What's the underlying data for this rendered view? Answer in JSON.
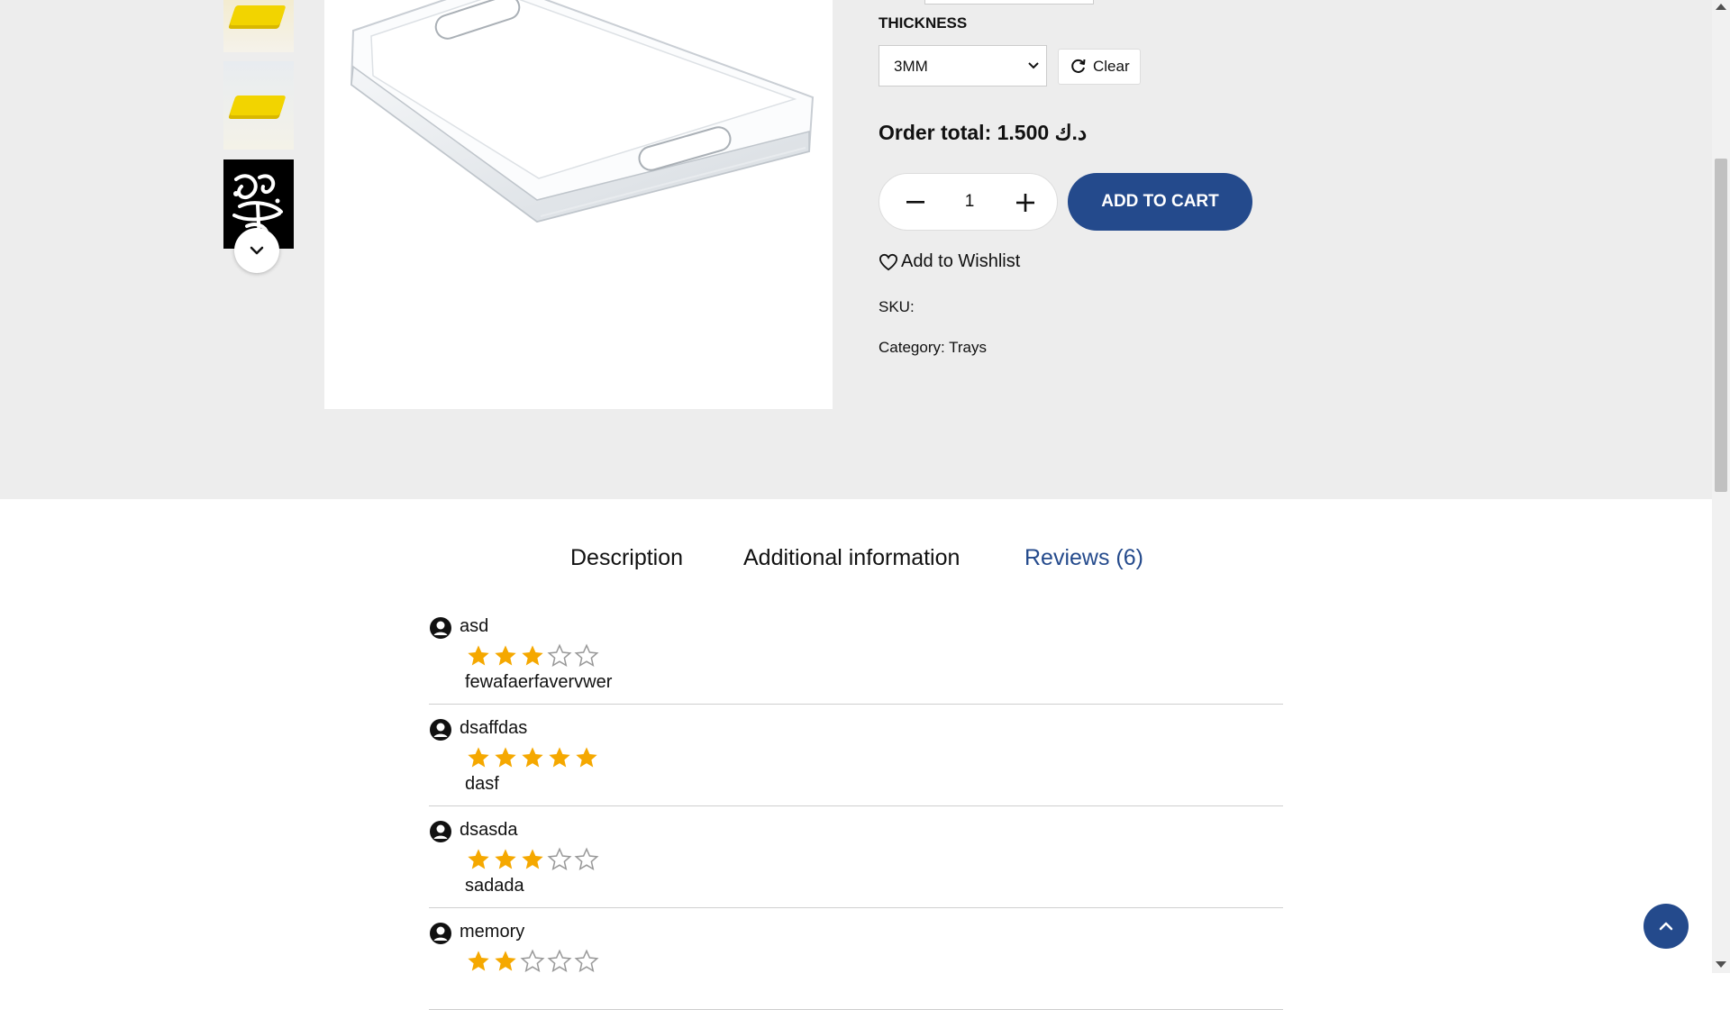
{
  "variation": {
    "label": "THICKNESS",
    "selected": "3MM",
    "clear_label": "Clear"
  },
  "order_total": {
    "text": "Order total: 1.500 د.ك"
  },
  "quantity": {
    "value": "1"
  },
  "cart": {
    "add_label": "ADD TO CART"
  },
  "wishlist": {
    "label": "Add to Wishlist"
  },
  "meta": {
    "sku_label": "SKU:",
    "category_label": "Category:",
    "category_value": "Trays"
  },
  "tabs": {
    "description": "Description",
    "additional": "Additional information",
    "reviews": "Reviews (6)"
  },
  "reviews": [
    {
      "author": "asd",
      "rating": 3,
      "text": "fewafaerfavervwer"
    },
    {
      "author": "dsaffdas",
      "rating": 5,
      "text": "dasf"
    },
    {
      "author": "dsasda",
      "rating": 3,
      "text": "sadada"
    },
    {
      "author": "memory",
      "rating": 2,
      "text": ""
    }
  ],
  "colors": {
    "brand_blue": "#244a8c",
    "star_filled": "#f5a800",
    "page_band": "#ededed"
  },
  "icons": {
    "scroll_down": "chevron-down-icon",
    "refresh": "refresh-icon",
    "minus": "minus-icon",
    "plus": "plus-icon",
    "heart": "heart-icon",
    "user": "user-circle-icon",
    "star": "star-icon",
    "back_to_top": "chevron-up-icon"
  }
}
